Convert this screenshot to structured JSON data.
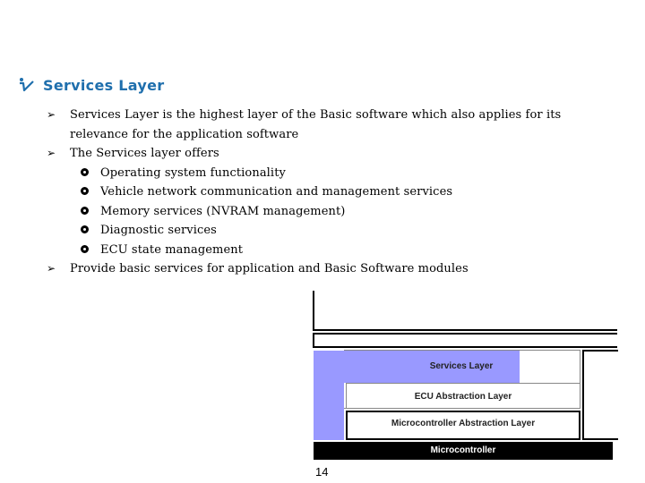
{
  "slide": {
    "title": "Services Layer",
    "title_color": "#1f6fad",
    "title_icon": "checkmark-icon",
    "bullets": [
      {
        "type": "arrow",
        "lines": [
          "Services Layer is the highest layer of the Basic software which also applies for its",
          "relevance for the application software"
        ]
      },
      {
        "type": "arrow",
        "lines": [
          "The Services layer offers"
        ]
      }
    ],
    "sub_bullets": [
      "Operating system functionality",
      "Vehicle network communication and management services",
      "Memory services (NVRAM management)",
      "Diagnostic services",
      "ECU state management"
    ],
    "last_bullet": "Provide basic services for application and Basic Software modules",
    "arrow_glyph": "➢",
    "page_number": "14"
  },
  "diagram": {
    "services_color": "#9999ff",
    "layers": {
      "services": "Services Layer",
      "ecu": "ECU Abstraction Layer",
      "mcal": "Microcontroller Abstraction Layer",
      "microcontroller": "Microcontroller"
    }
  }
}
